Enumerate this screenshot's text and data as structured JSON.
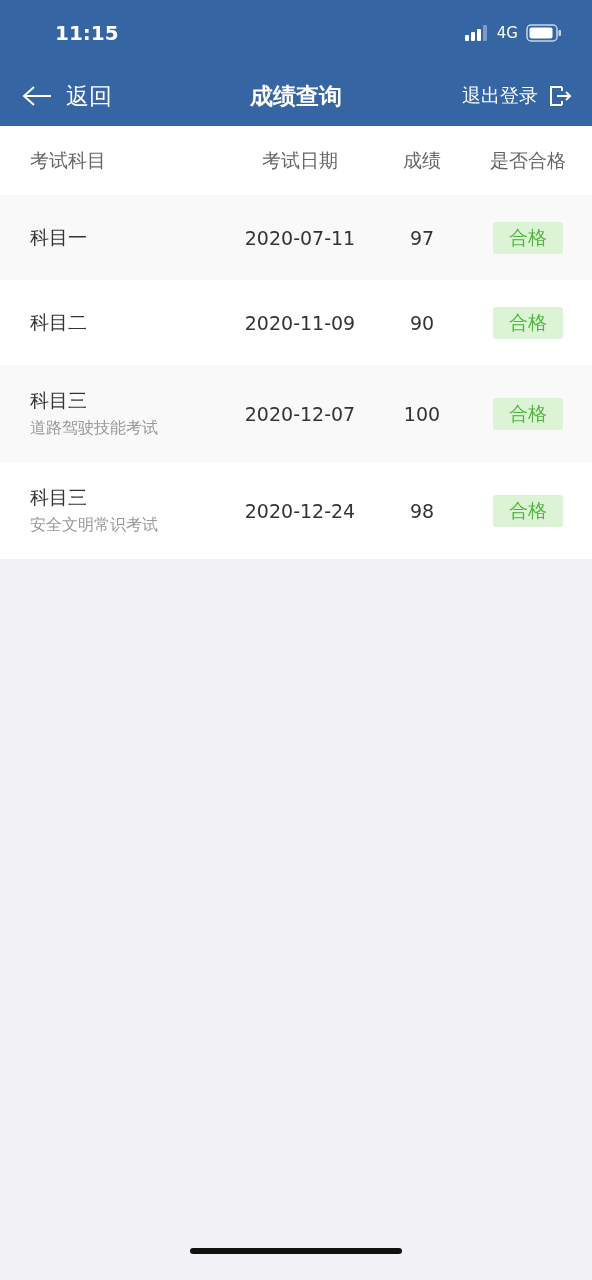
{
  "status_bar": {
    "time": "11:15",
    "network": "4G"
  },
  "nav_bar": {
    "back": "返回",
    "title": "成绩查询",
    "logout": "退出登录"
  },
  "table": {
    "columns": [
      "考试科目",
      "考试日期",
      "成绩",
      "是否合格"
    ],
    "rows": [
      {
        "subject": "科目一",
        "date": "2020-07-11",
        "score": "97",
        "result": {
          "text": "合格",
          "kind": "pass"
        }
      },
      {
        "subject": "科目二",
        "date": "2020-11-09",
        "score": "90",
        "result": {
          "text": "合格",
          "kind": "pass"
        }
      },
      {
        "subject": "科目三",
        "note": "道路驾驶技能考试",
        "date": "2020-12-07",
        "score": "100",
        "result": {
          "text": "合格",
          "kind": "pass"
        }
      },
      {
        "subject": "科目三",
        "note": "安全文明常识考试",
        "date": "2020-12-24",
        "score": "98",
        "result": {
          "text": "合格",
          "kind": "pass"
        }
      }
    ]
  }
}
